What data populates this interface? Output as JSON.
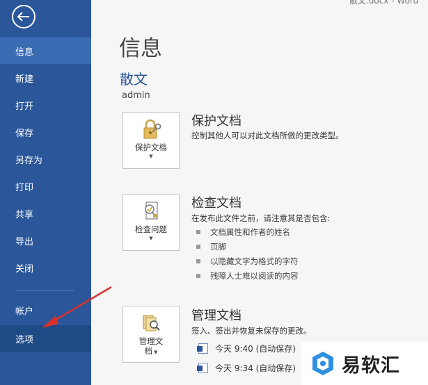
{
  "window": {
    "title_fragment": "散文.docx - Word"
  },
  "sidebar": {
    "items": [
      {
        "label": "信息"
      },
      {
        "label": "新建"
      },
      {
        "label": "打开"
      },
      {
        "label": "保存"
      },
      {
        "label": "另存为"
      },
      {
        "label": "打印"
      },
      {
        "label": "共享"
      },
      {
        "label": "导出"
      },
      {
        "label": "关闭"
      },
      {
        "label": "帐户"
      },
      {
        "label": "选项"
      }
    ]
  },
  "main": {
    "page_title": "信息",
    "doc_name": "散文",
    "doc_path": "admin",
    "protect": {
      "tile_label": "保护文档",
      "title": "保护文档",
      "desc": "控制其他人可以对此文档所做的更改类型。"
    },
    "inspect": {
      "tile_label": "检查问题",
      "title": "检查文档",
      "desc": "在发布此文件之前，请注意其是否包含:",
      "bullets": [
        "文档属性和作者的姓名",
        "页脚",
        "以隐藏文字为格式的字符",
        "残障人士难以阅读的内容"
      ]
    },
    "manage": {
      "tile_label_1": "管理文",
      "tile_label_2": "档",
      "title": "管理文档",
      "desc": "签入、签出并恢复未保存的更改。",
      "versions": [
        "今天 9:40 (自动保存)",
        "今天 9:34 (自动保存)"
      ]
    }
  },
  "watermark": {
    "text": "易软汇"
  },
  "colors": {
    "sidebar": "#2b579a",
    "accent": "#2b579a",
    "annotation_arrow": "#d9302a"
  }
}
